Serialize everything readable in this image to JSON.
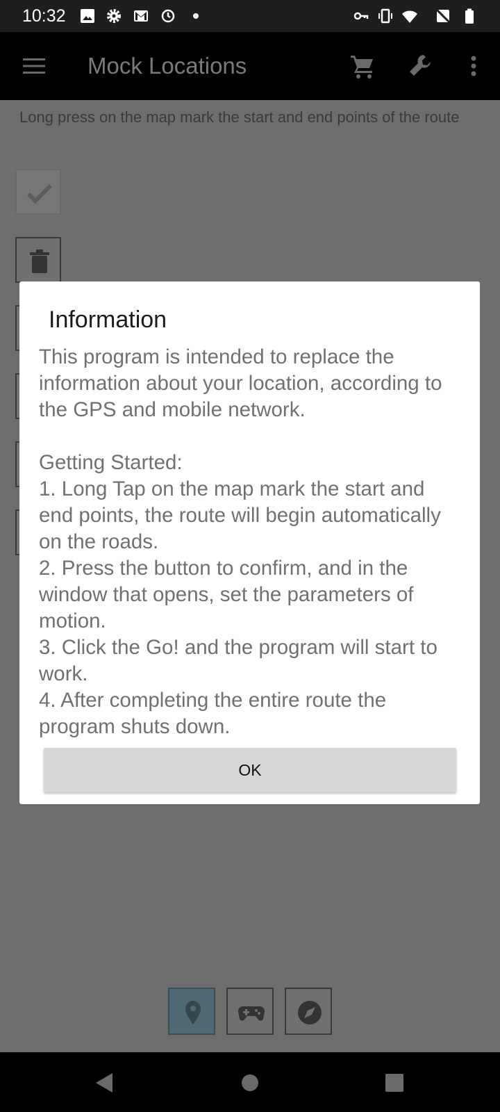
{
  "status_bar": {
    "time": "10:32",
    "left_icons": [
      "image-icon",
      "gear-icon",
      "gmail-icon",
      "sync-icon",
      "dot-icon"
    ],
    "right_icons": [
      "vpn-key-icon",
      "vibrate-icon",
      "wifi-icon",
      "no-signal-icon",
      "battery-icon"
    ]
  },
  "app_bar": {
    "title": "Mock Locations",
    "icons": [
      "menu-icon",
      "cart-icon",
      "wrench-icon",
      "overflow-menu-icon"
    ]
  },
  "content": {
    "hint": "Long press on the map mark the start and end points of the route",
    "tool_buttons": [
      "check-icon",
      "trash-icon"
    ]
  },
  "bottom_modes": {
    "buttons": [
      "location-pin-icon",
      "gamepad-icon",
      "compass-icon"
    ],
    "active_index": 0
  },
  "dialog": {
    "title": "Information",
    "body": "This program is intended to replace the information about your location, according to the GPS and mobile network.\n\n Getting Started:\n 1. Long Tap on the map mark the start and end points, the route will begin automatically on the roads.\n 2. Press the button to confirm, and in the window that opens, set the parameters of motion.\n 3. Click the Go! and the program will start to work.\n 4. After completing the entire route the program shuts down.",
    "ok_label": "OK"
  },
  "nav_bar": {
    "icons": [
      "back-icon",
      "home-icon",
      "recents-icon"
    ]
  },
  "colors": {
    "scrim": "#6e6e6e",
    "app_bar": "#000000",
    "dialog_bg": "#ffffff",
    "button_bg": "#d7d7d7"
  }
}
